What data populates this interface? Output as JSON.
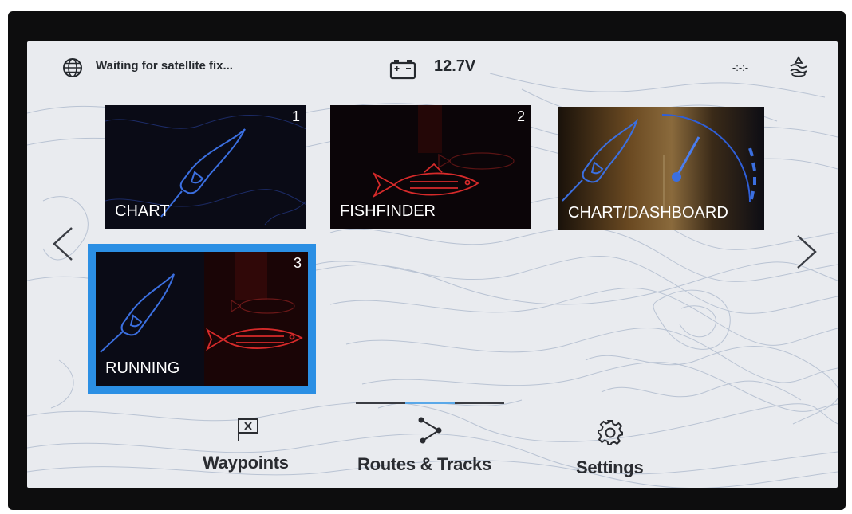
{
  "status_bar": {
    "gps_status": "Waiting for satellite fix...",
    "battery_voltage": "12.7V",
    "data_indicator": "-:-:-",
    "icons": [
      "globe-icon",
      "battery-icon",
      "nmea-data-icon",
      "ais-icon"
    ]
  },
  "navigation": {
    "prev_icon": "chevron-left-icon",
    "next_icon": "chevron-right-icon",
    "current_page": 2,
    "page_count": 3
  },
  "app_tiles": [
    {
      "label": "CHART",
      "number": "1",
      "icon": "boat-icon",
      "selected": false
    },
    {
      "label": "FISHFINDER",
      "number": "2",
      "icon": "fish-icon",
      "selected": false
    },
    {
      "label": "CHART/DASHBOARD",
      "number": "",
      "icon": "gauge-icon",
      "selected": false
    },
    {
      "label": "RUNNING",
      "number": "3",
      "icon": "boat-fish-icon",
      "selected": true
    }
  ],
  "bottom_nav": [
    {
      "label": "Waypoints",
      "icon": "waypoint-flag-icon"
    },
    {
      "label": "Routes & Tracks",
      "icon": "route-icon"
    },
    {
      "label": "Settings",
      "icon": "gear-icon"
    }
  ],
  "colors": {
    "screen_background": "#e9ebef",
    "selection": "#2b8fe4",
    "chart_blue": "#3b6fe0",
    "sonar_red": "#d62a2a",
    "text_dark": "#25292e"
  }
}
